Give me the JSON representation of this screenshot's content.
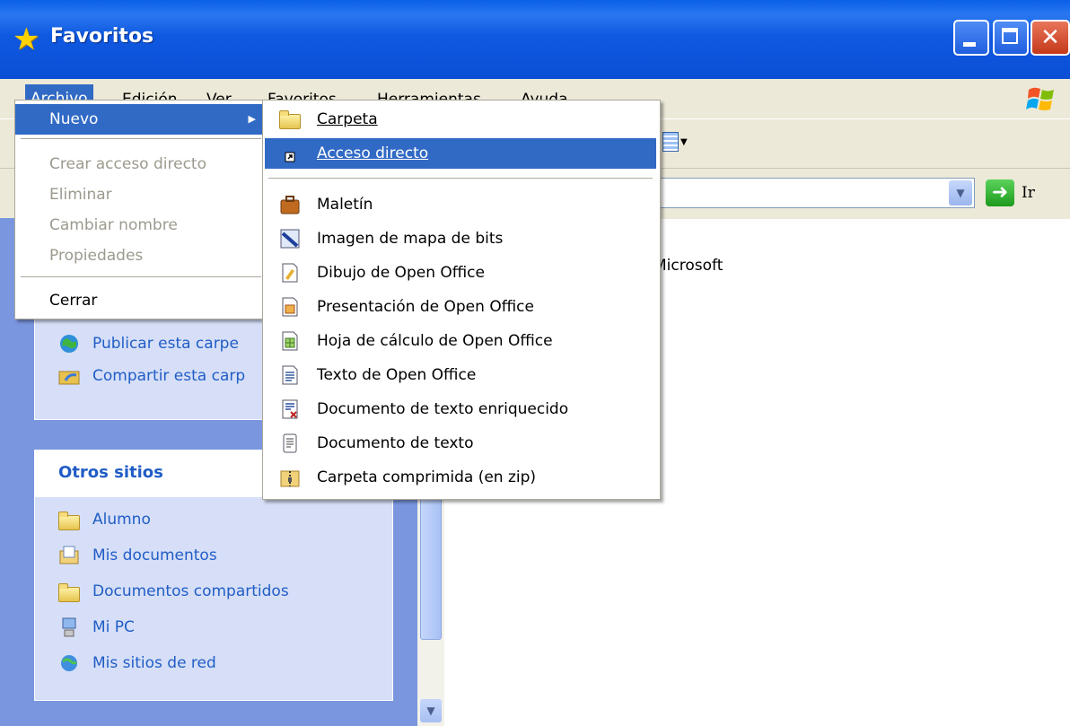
{
  "window": {
    "title": "Favoritos"
  },
  "menubar": {
    "items": [
      "Archivo",
      "Edición",
      "Ver",
      "Favoritos",
      "Herramientas",
      "Ayuda"
    ]
  },
  "address": {
    "go_label": "Ir"
  },
  "content": {
    "partial_text": "Microsoft"
  },
  "archivo_menu": {
    "nuevo": "Nuevo",
    "crear_acceso": "Crear acceso directo",
    "eliminar": "Eliminar",
    "cambiar_nombre": "Cambiar nombre",
    "propiedades": "Propiedades",
    "cerrar": "Cerrar"
  },
  "nuevo_menu": [
    {
      "label": "Carpeta",
      "icon": "folder-icon"
    },
    {
      "label": "Acceso directo",
      "icon": "shortcut-icon"
    },
    {
      "label": "Maletín",
      "icon": "briefcase-icon"
    },
    {
      "label": "Imagen de mapa de bits",
      "icon": "bitmap-icon"
    },
    {
      "label": "Dibujo de Open Office",
      "icon": "oo-draw-icon"
    },
    {
      "label": "Presentación de Open Office",
      "icon": "oo-impress-icon"
    },
    {
      "label": "Hoja de cálculo de Open Office",
      "icon": "oo-calc-icon"
    },
    {
      "label": "Texto de Open Office",
      "icon": "oo-writer-icon"
    },
    {
      "label": "Documento de texto enriquecido",
      "icon": "rtf-icon"
    },
    {
      "label": "Documento de texto",
      "icon": "txt-icon"
    },
    {
      "label": "Carpeta comprimida (en zip)",
      "icon": "zip-icon"
    }
  ],
  "tasks_panel": {
    "links": [
      "Publicar esta carpe",
      "Compartir esta carp"
    ]
  },
  "other_places": {
    "title": "Otros sitios",
    "links": [
      "Alumno",
      "Mis documentos",
      "Documentos compartidos",
      "Mi PC",
      "Mis sitios de red"
    ]
  }
}
